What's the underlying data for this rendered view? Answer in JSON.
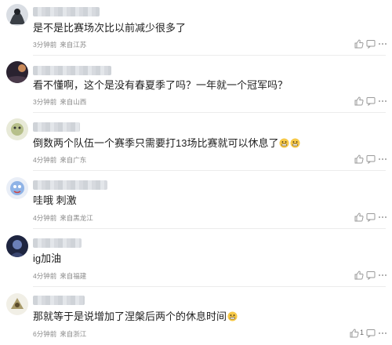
{
  "comments": [
    {
      "text": "是不是比赛场次比以前减少很多了",
      "time": "3分钟前",
      "location": "来自江苏",
      "likes": ""
    },
    {
      "text": "看不懂啊，这个是没有春夏季了吗？一年就一个冠军吗？",
      "time": "3分钟前",
      "location": "来自山西",
      "likes": ""
    },
    {
      "text": "倒数两个队伍一个赛季只需要打13场比赛就可以休息了",
      "time": "4分钟前",
      "location": "来自广东",
      "likes": ""
    },
    {
      "text": "哇哦 刺激",
      "time": "4分钟前",
      "location": "来自黑龙江",
      "likes": ""
    },
    {
      "text": "ig加油",
      "time": "4分钟前",
      "location": "来自福建",
      "likes": ""
    },
    {
      "text": "那就等于是说增加了涅槃后两个的休息时间",
      "time": "6分钟前",
      "location": "来自浙江",
      "likes": "1"
    }
  ],
  "icons": {
    "like": "thumbs-up-icon",
    "reply": "comment-bubble-icon",
    "more": "more-dots-icon",
    "emoji": "grimace-emoji-icon"
  },
  "colors": {
    "text": "#222222",
    "meta": "#8a8a8a",
    "icon": "#9a9a9a"
  }
}
